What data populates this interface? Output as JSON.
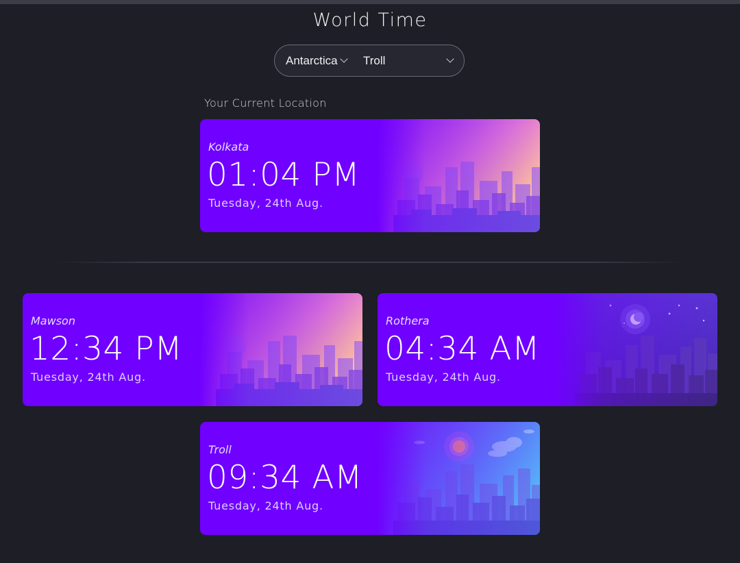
{
  "page": {
    "title": "World Time"
  },
  "picker": {
    "region": "Antarctica",
    "city": "Troll"
  },
  "current_location_label": "Your Current Location",
  "current": {
    "city": "Kolkata",
    "time": "01:04 PM",
    "date": "Tuesday, 24th Aug.",
    "scene": "sunset"
  },
  "clocks": [
    {
      "city": "Mawson",
      "time": "12:34 PM",
      "date": "Tuesday, 24th Aug.",
      "scene": "sunset"
    },
    {
      "city": "Rothera",
      "time": "04:34 AM",
      "date": "Tuesday, 24th Aug.",
      "scene": "night"
    },
    {
      "city": "Troll",
      "time": "09:34 AM",
      "date": "Tuesday, 24th Aug.",
      "scene": "day"
    }
  ],
  "colors": {
    "background": "#1d1e26",
    "card": "#7000ff",
    "picker_border": "#6a6b74"
  },
  "icons": {
    "dropdown": "chevron-down-icon",
    "moon": "moon-icon",
    "sun": "sun-icon"
  }
}
